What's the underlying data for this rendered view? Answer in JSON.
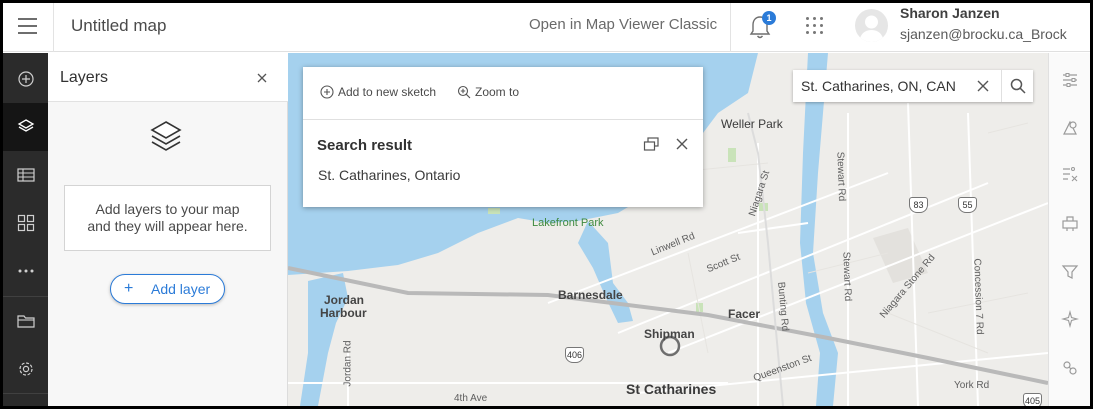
{
  "header": {
    "title": "Untitled map",
    "open_classic": "Open in Map Viewer Classic",
    "notifications_count": "1",
    "user_name": "Sharon Janzen",
    "user_email": "sjanzen@brocku.ca_Brock"
  },
  "toolbar": {
    "items": [
      "add-icon",
      "layers-icon",
      "table-icon",
      "basemap-icon",
      "more-icon",
      "folder-icon",
      "settings-icon"
    ],
    "active": "layers-icon"
  },
  "layers_panel": {
    "title": "Layers",
    "empty_line1": "Add layers to your map",
    "empty_line2": "and they will appear here.",
    "add_layer_label": "Add layer",
    "add_layer_symbol": "+"
  },
  "popup": {
    "add_to_sketch": "Add to new sketch",
    "zoom_to": "Zoom to",
    "title": "Search result",
    "body": "St. Catharines, Ontario"
  },
  "search": {
    "value": "St. Catharines, ON, CAN"
  },
  "map": {
    "places": {
      "weller_park": "Weller Park",
      "lakefront_park": "Lakefront Park",
      "barnesdale": "Barnesdale",
      "facer": "Facer",
      "shipman": "Shipman",
      "st_catharines": "St Catharines",
      "jordan": "Jordan",
      "harbour": "Harbour"
    },
    "streets": {
      "niagara_st": "Niagara St",
      "linwell_rd": "Linwell Rd",
      "scott_st": "Scott St",
      "bunting_rd": "Bunting Rd",
      "stewart_rd_1": "Stewart Rd",
      "stewart_rd_2": "Stewart Rd",
      "niagara_stone_rd": "Niagara Stone Rd",
      "concession_7_rd": "Concession 7 Rd",
      "jordan_rd": "Jordan Rd",
      "fourth_ave": "4th Ave",
      "queenston_st": "Queenston St",
      "york_rd": "York Rd"
    },
    "shields": {
      "r406": "406",
      "r83": "83",
      "r55": "55",
      "r405": "405"
    }
  },
  "right_toolbar": {
    "items": [
      "properties-icon",
      "styles-icon",
      "filter-config-icon",
      "configure-popups-icon",
      "filter-icon",
      "effects-icon",
      "sketch-icon"
    ]
  },
  "colors": {
    "water": "#a5d1ee",
    "land": "#eeedea",
    "accent": "#2b7bd8",
    "toolbar_bg": "#2b2b2b"
  }
}
